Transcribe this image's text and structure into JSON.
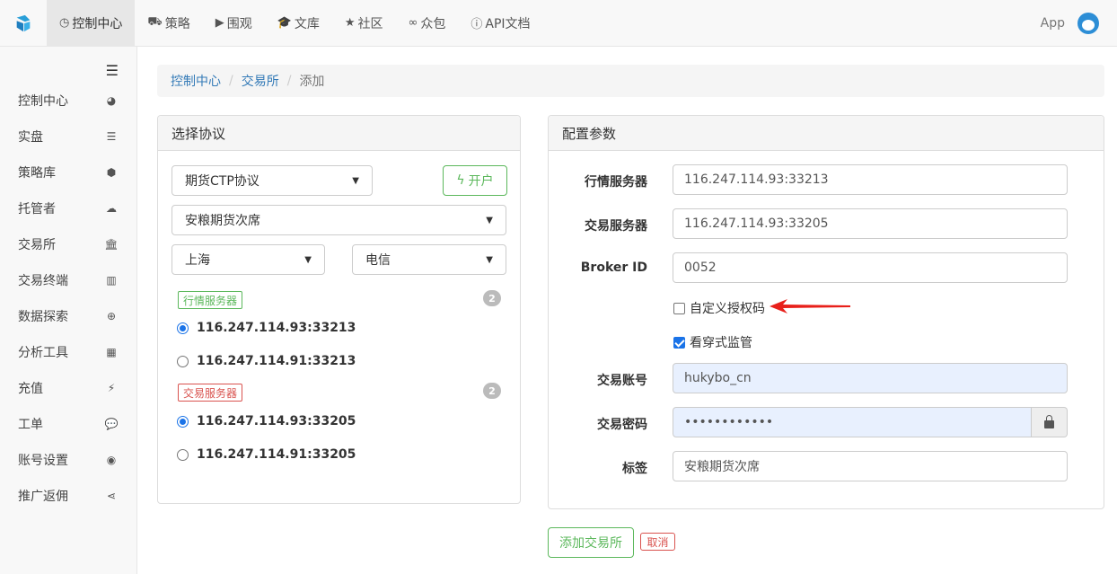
{
  "navbar": {
    "items": [
      {
        "label": "控制中心",
        "icon": "dashboard-icon",
        "glyph": "◷",
        "active": true
      },
      {
        "label": "策略",
        "icon": "cart-icon",
        "glyph": "⛟",
        "active": false
      },
      {
        "label": "围观",
        "icon": "play-circle-icon",
        "glyph": "▶",
        "active": false
      },
      {
        "label": "文库",
        "icon": "graduation-cap-icon",
        "glyph": "🎓",
        "active": false
      },
      {
        "label": "社区",
        "icon": "star-icon",
        "glyph": "★",
        "active": false
      },
      {
        "label": "众包",
        "icon": "glasses-icon",
        "glyph": "∞",
        "active": false
      },
      {
        "label": "API文档",
        "icon": "info-icon",
        "glyph": "ⓘ",
        "active": false
      }
    ],
    "app_label": "App"
  },
  "sidebar": {
    "items": [
      {
        "label": "控制中心",
        "icon": "dashboard-icon",
        "glyph": "◕"
      },
      {
        "label": "实盘",
        "icon": "server-icon",
        "glyph": "☰"
      },
      {
        "label": "策略库",
        "icon": "cube-icon",
        "glyph": "⬢"
      },
      {
        "label": "托管者",
        "icon": "cloud-icon",
        "glyph": "☁"
      },
      {
        "label": "交易所",
        "icon": "bank-icon",
        "glyph": "🏛"
      },
      {
        "label": "交易终端",
        "icon": "bar-chart-icon",
        "glyph": "▥"
      },
      {
        "label": "数据探索",
        "icon": "zoom-icon",
        "glyph": "⊕"
      },
      {
        "label": "分析工具",
        "icon": "calculator-icon",
        "glyph": "▦"
      },
      {
        "label": "充值",
        "icon": "plug-icon",
        "glyph": "⚡"
      },
      {
        "label": "工单",
        "icon": "comment-icon",
        "glyph": "💬"
      },
      {
        "label": "账号设置",
        "icon": "user-circle-icon",
        "glyph": "◉"
      },
      {
        "label": "推广返佣",
        "icon": "share-icon",
        "glyph": "⋖"
      }
    ]
  },
  "breadcrumb": {
    "items": [
      "控制中心",
      "交易所"
    ],
    "current": "添加"
  },
  "left_panel": {
    "title": "选择协议",
    "protocol": "期货CTP协议",
    "open_button": "开户",
    "broker": "安粮期货次席",
    "region": "上海",
    "carrier": "电信",
    "market_server_tag": "行情服务器",
    "market_server_count": "2",
    "market_servers": [
      {
        "address": "116.247.114.93:33213",
        "checked": true
      },
      {
        "address": "116.247.114.91:33213",
        "checked": false
      }
    ],
    "trade_server_tag": "交易服务器",
    "trade_server_count": "2",
    "trade_servers": [
      {
        "address": "116.247.114.93:33205",
        "checked": true
      },
      {
        "address": "116.247.114.91:33205",
        "checked": false
      }
    ]
  },
  "right_panel": {
    "title": "配置参数",
    "market_server_label": "行情服务器",
    "market_server_value": "116.247.114.93:33213",
    "trade_server_label": "交易服务器",
    "trade_server_value": "116.247.114.93:33205",
    "broker_id_label": "Broker ID",
    "broker_id_value": "0052",
    "custom_auth_label": "自定义授权码",
    "custom_auth_checked": false,
    "penetration_label": "看穿式监管",
    "penetration_checked": true,
    "account_label": "交易账号",
    "account_value": "hukybo_cn",
    "password_label": "交易密码",
    "password_value": "••••••••••••",
    "tag_label": "标签",
    "tag_value": "安粮期货次席"
  },
  "actions": {
    "add_label": "添加交易所",
    "cancel_label": "取消"
  },
  "colors": {
    "success": "#5cb85c",
    "danger": "#d9534f",
    "link": "#337ab7",
    "arrow": "#e8201a"
  }
}
